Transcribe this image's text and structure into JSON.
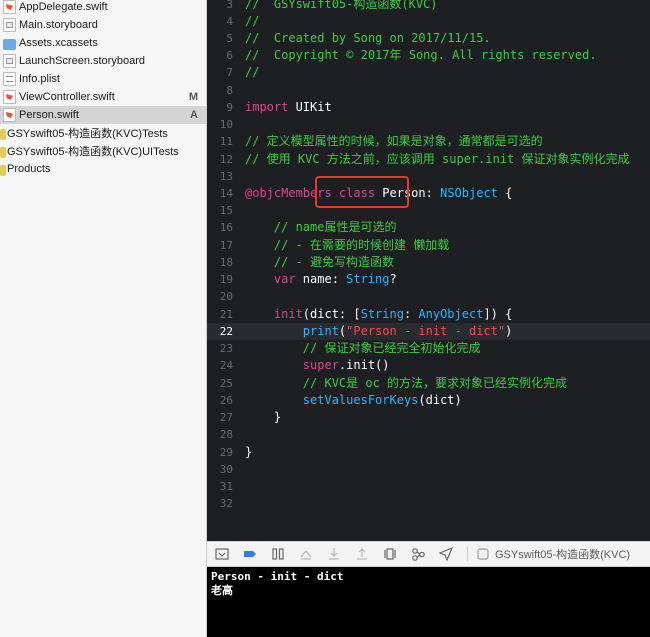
{
  "navigator": {
    "items": [
      {
        "label": "AppDelegate.swift",
        "icon": "swift-file-icon",
        "badge": ""
      },
      {
        "label": "Main.storyboard",
        "icon": "storyboard-file-icon",
        "badge": ""
      },
      {
        "label": "Assets.xcassets",
        "icon": "assets-folder-icon",
        "badge": ""
      },
      {
        "label": "LaunchScreen.storyboard",
        "icon": "storyboard-file-icon",
        "badge": ""
      },
      {
        "label": "Info.plist",
        "icon": "plist-file-icon",
        "badge": ""
      },
      {
        "label": "ViewController.swift",
        "icon": "swift-file-icon",
        "badge": "M"
      },
      {
        "label": "Person.swift",
        "icon": "swift-file-icon",
        "badge": "A",
        "selected": true
      },
      {
        "label": "GSYswift05-构造函数(KVC)Tests",
        "icon": "folder-icon",
        "badge": ""
      },
      {
        "label": "GSYswift05-构造函数(KVC)UITests",
        "icon": "folder-icon",
        "badge": ""
      },
      {
        "label": "Products",
        "icon": "folder-icon",
        "badge": ""
      }
    ]
  },
  "editor": {
    "line_numbers": [
      "3",
      "4",
      "5",
      "6",
      "7",
      "8",
      "9",
      "10",
      "11",
      "12",
      "13",
      "14",
      "15",
      "16",
      "17",
      "18",
      "19",
      "20",
      "21",
      "22",
      "23",
      "24",
      "25",
      "26",
      "27",
      "28",
      "29",
      "30",
      "31",
      "32"
    ],
    "lines": {
      "l3": "//  GSYswift05-构造函数(KVC)",
      "l4": "//",
      "l5": "//  Created by Song on 2017/11/15.",
      "l6": "//  Copyright © 2017年 Song. All rights reserved.",
      "l7": "//",
      "l9_kw": "import",
      "l9_rest": " UIKit",
      "l11": "// 定义模型属性的时候，如果是对象，通常都是可选的",
      "l12": "// 使用 KVC 方法之前，应该调用 super.init 保证对象实例化完成",
      "l14_attr": "@objcMembers",
      "l14_kw": " class",
      "l14_name": " Person: ",
      "l14_type": "NSObject",
      "l14_end": " {",
      "l16": "    // name属性是可选的",
      "l17": "    // - 在需要的时候创建 懒加载",
      "l18": "    // - 避免写构造函数",
      "l19_kw": "    var",
      "l19_mid": " name: ",
      "l19_type": "String",
      "l19_end": "?",
      "l21_kw": "    init",
      "l21_a": "(dict: [",
      "l21_t1": "String",
      "l21_b": ": ",
      "l21_t2": "AnyObject",
      "l21_c": "]) {",
      "l22_fn": "        print",
      "l22_a": "(",
      "l22_str": "\"Person - init - dict\"",
      "l22_b": ")",
      "l23": "        // 保证对象已经完全初始化完成",
      "l24_kw": "        super",
      "l24_rest": ".init()",
      "l25": "        // KVC是 oc 的方法，要求对象已经实例化完成",
      "l26_fn": "        setValuesForKeys",
      "l26_rest": "(dict)",
      "l27": "    }",
      "l29": "}"
    }
  },
  "debug_bar": {
    "process_label": "GSYswift05-构造函数(KVC)"
  },
  "console": {
    "lines": [
      "Person - init - dict",
      "老高"
    ]
  }
}
